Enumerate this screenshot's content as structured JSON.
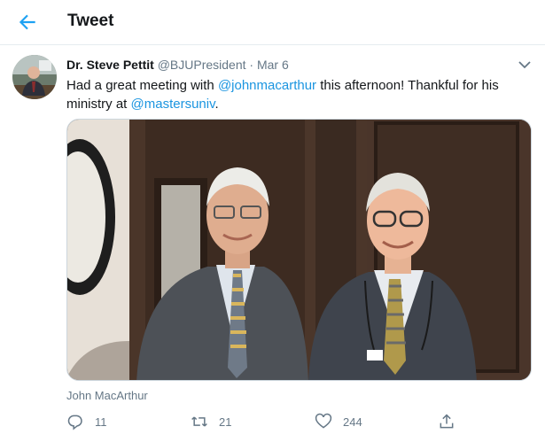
{
  "header": {
    "title": "Tweet"
  },
  "tweet": {
    "author_name": "Dr. Steve Pettit",
    "author_handle": "@BJUPresident",
    "separator": "·",
    "date": "Mar 6",
    "text_1": "Had a great meeting with ",
    "mention_1": "@johnmacarthur",
    "text_2": " this afternoon! Thankful for his ministry at ",
    "mention_2": "@mastersuniv",
    "text_3": ".",
    "tagged_person": "John MacArthur"
  },
  "actions": {
    "reply_count": "11",
    "retweet_count": "21",
    "like_count": "244"
  },
  "colors": {
    "accent": "#1da1f2",
    "link": "#1b95e0",
    "muted": "#657786"
  }
}
